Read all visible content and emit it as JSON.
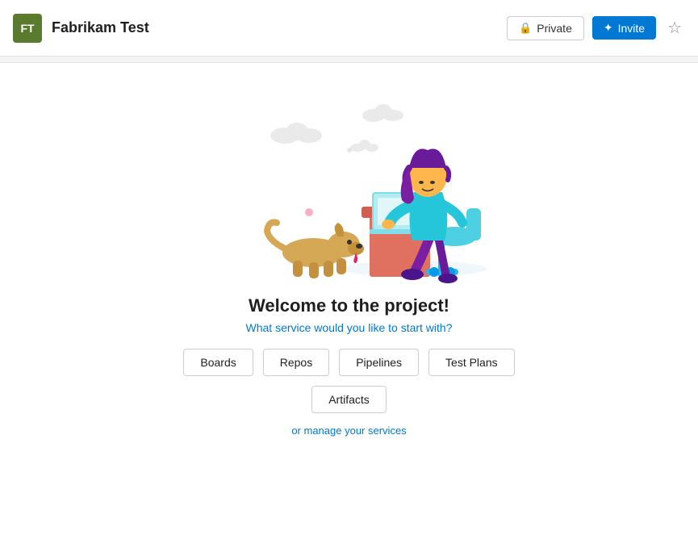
{
  "header": {
    "avatar_initials": "FT",
    "project_name": "Fabrikam Test",
    "private_label": "Private",
    "invite_label": "Invite",
    "star_symbol": "☆"
  },
  "main": {
    "welcome_title": "Welcome to the project!",
    "welcome_subtitle": "What service would you like to start with?",
    "services_row1": [
      "Boards",
      "Repos",
      "Pipelines",
      "Test Plans"
    ],
    "services_row2": [
      "Artifacts"
    ],
    "manage_link": "or manage your services"
  }
}
